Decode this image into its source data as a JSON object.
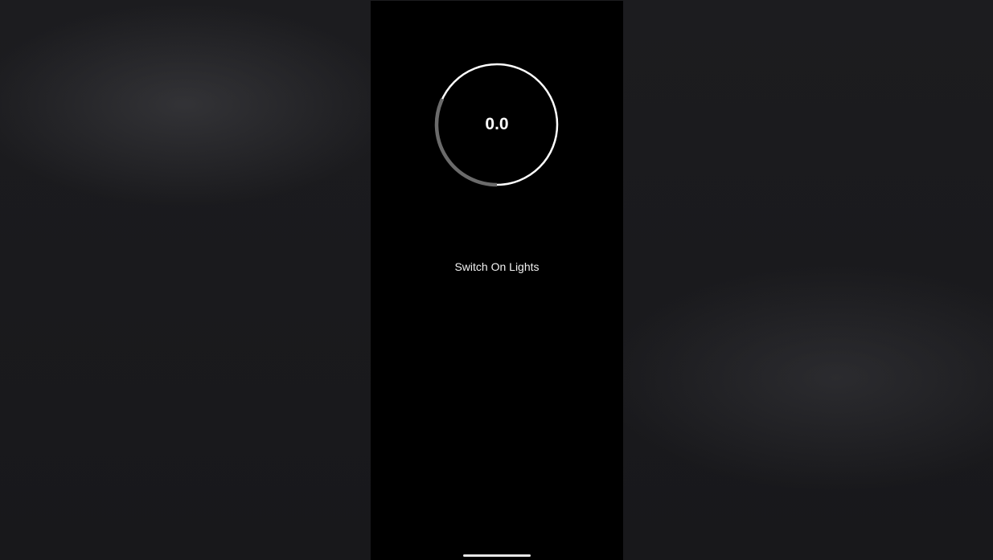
{
  "gauge": {
    "value_text": "0.0",
    "progress_fraction": 0.32,
    "track_color": "#ffffff",
    "progress_color": "#6b6b6b"
  },
  "actions": {
    "lights_label": "Switch On Lights"
  },
  "colors": {
    "screen_background": "#000000",
    "wallpaper": "#1b1b1e"
  }
}
